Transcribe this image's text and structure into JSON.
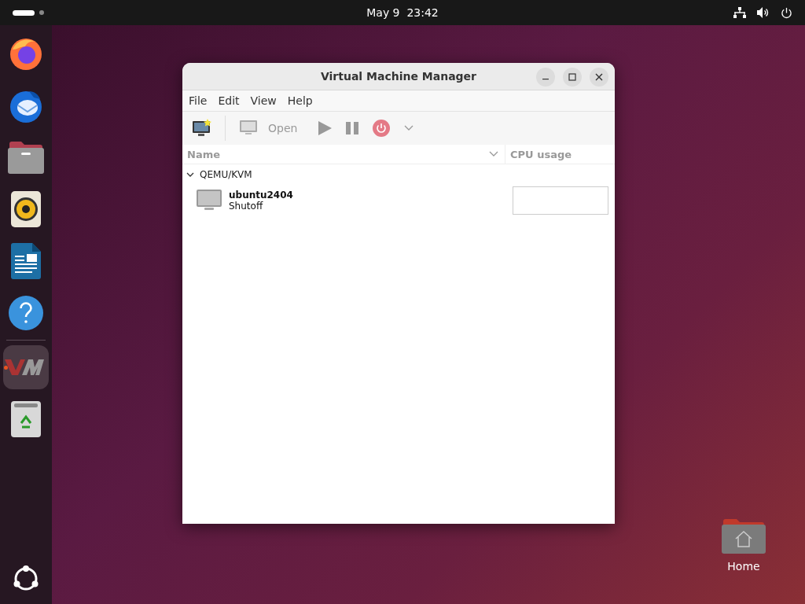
{
  "top_bar": {
    "clock": "May 9  23:42"
  },
  "dock": {
    "items": [
      {
        "kind": "browser",
        "selected": false,
        "running": false
      },
      {
        "kind": "mail",
        "selected": false,
        "running": false
      },
      {
        "kind": "files",
        "selected": false,
        "running": false
      },
      {
        "kind": "music",
        "selected": false,
        "running": false
      },
      {
        "kind": "document",
        "selected": false,
        "running": false
      },
      {
        "kind": "help",
        "selected": false,
        "running": false
      },
      {
        "kind": "vm",
        "selected": true,
        "running": true
      },
      {
        "kind": "trash",
        "selected": false,
        "running": false
      }
    ]
  },
  "window": {
    "title": "Virtual Machine Manager",
    "menu": [
      "File",
      "Edit",
      "View",
      "Help"
    ],
    "toolbar": {
      "open_label": "Open"
    },
    "table": {
      "columns": [
        "Name",
        "CPU usage"
      ],
      "groups": [
        {
          "name": "QEMU/KVM",
          "expanded": true,
          "vms": [
            {
              "name": "ubuntu2404",
              "status": "Shutoff"
            }
          ]
        }
      ]
    }
  },
  "desktop_icons": [
    {
      "label": "Home"
    }
  ]
}
